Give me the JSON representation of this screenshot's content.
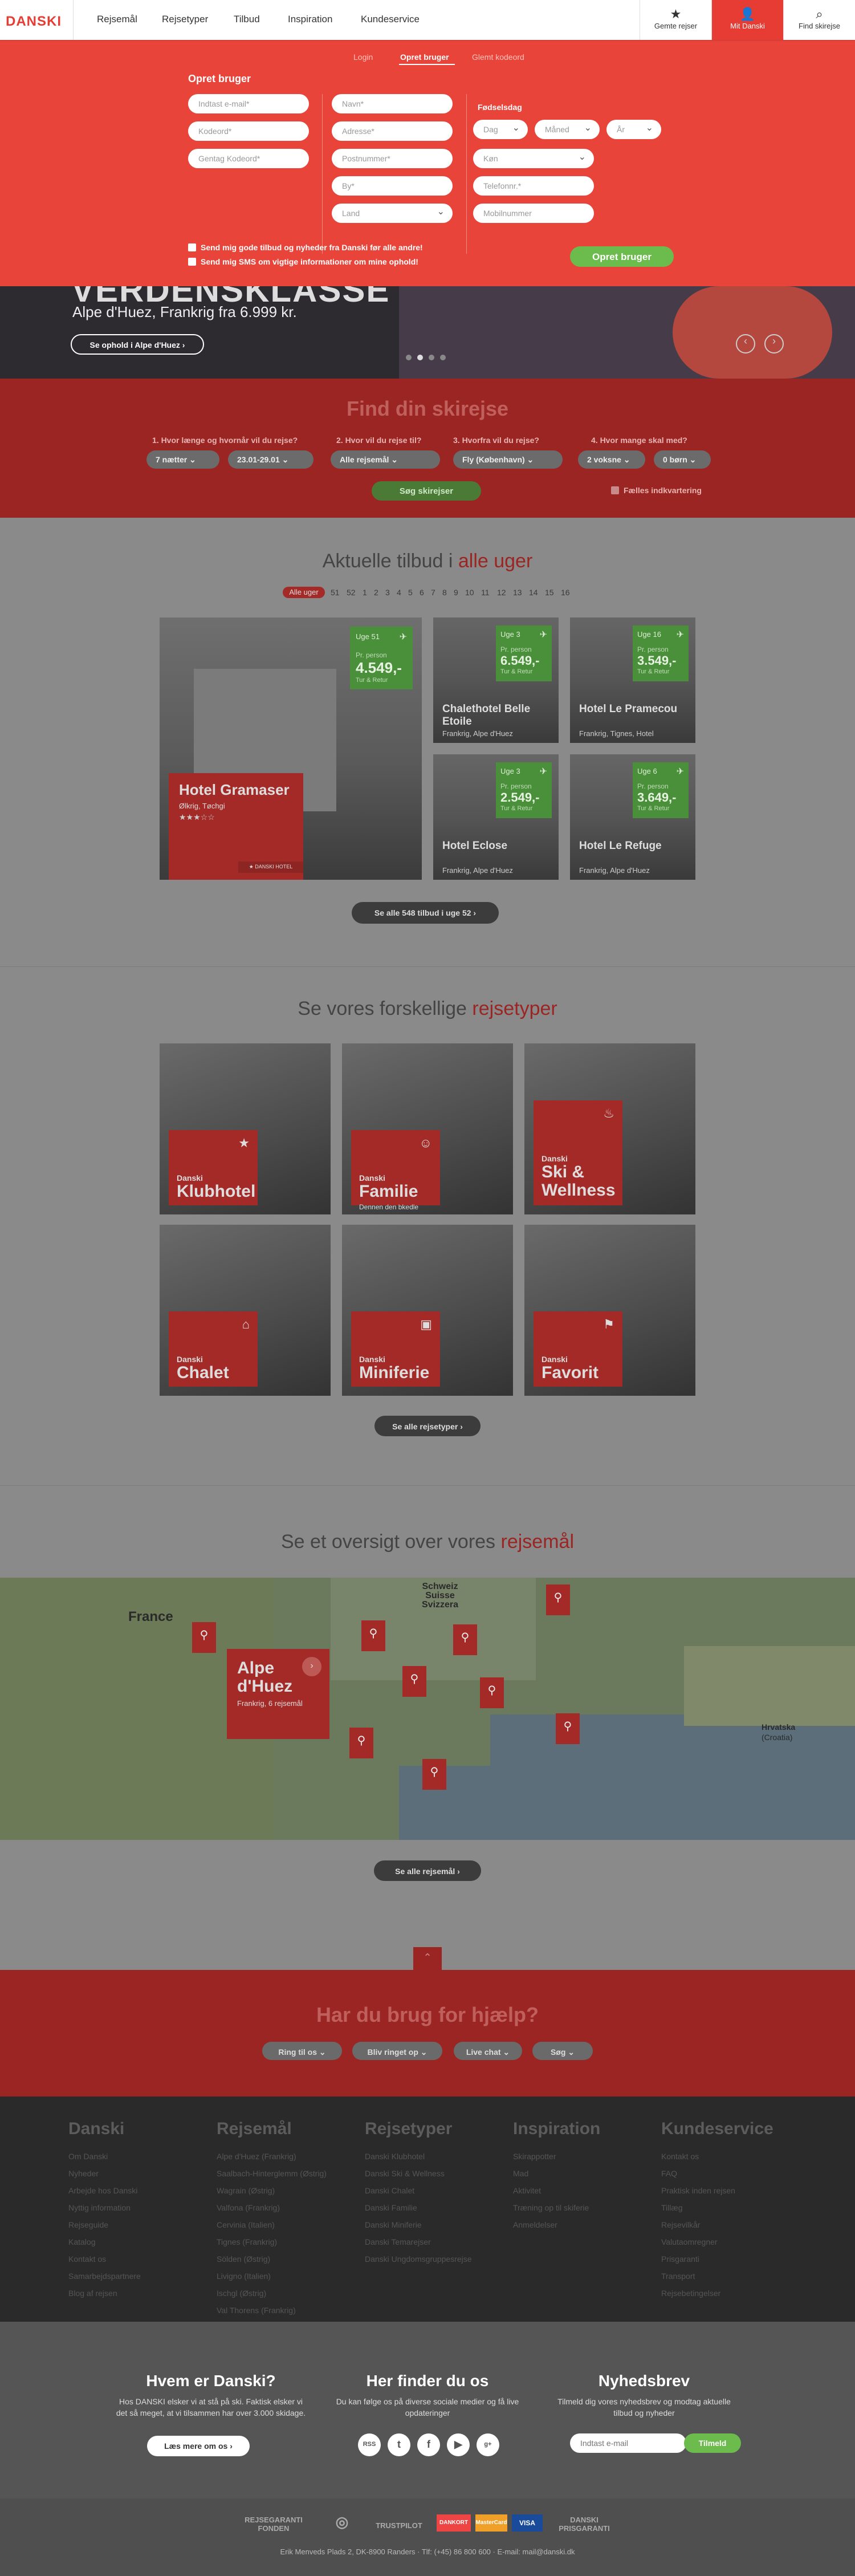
{
  "nav": {
    "logo": "DANSKI",
    "items": [
      "Rejsemål",
      "Rejsetyper",
      "Tilbud",
      "Inspiration",
      "Kundeservice"
    ],
    "saved": "Gemte rejser",
    "mine": "Mit Danski",
    "find": "Find skirejse"
  },
  "dropdown": {
    "tabs": [
      "Login",
      "Opret bruger",
      "Glemt kodeord"
    ],
    "heading": "Opret bruger",
    "col1": [
      "Indtast e-mail*",
      "Kodeord*",
      "Gentag Kodeord*"
    ],
    "col2": [
      "Navn*",
      "Adresse*",
      "Postnummer*",
      "By*",
      "Land"
    ],
    "birth_label": "Fødselsdag",
    "birth": [
      "Dag",
      "Måned",
      "År"
    ],
    "col3": [
      "Køn",
      "Telefonnr.*",
      "Mobilnummer"
    ],
    "check1": "Send mig gode tilbud og nyheder fra Danski før alle andre!",
    "check2": "Send mig SMS om vigtige informationer om mine ophold!",
    "submit": "Opret bruger"
  },
  "hero": {
    "headline": "VERDENSKLASSE",
    "sub": "Alpe d'Huez, Frankrig fra 6.999 kr.",
    "cta": "Se ophold i Alpe d'Huez",
    "prev": "‹",
    "next": "›"
  },
  "search": {
    "title": "Find din skirejse",
    "q": [
      "1. Hvor længe og hvornår vil du rejse?",
      "2. Hvor vil du rejse til?",
      "3. Hvorfra vil du rejse?",
      "4. Hvor mange skal med?"
    ],
    "values": [
      "7 nætter",
      "23.01-29.01",
      "Alle rejsemål",
      "Fly (København)",
      "2 voksne",
      "0 børn"
    ],
    "button": "Søg skirejser",
    "shared": "Fælles indkvartering"
  },
  "offers": {
    "title_a": "Aktuelle tilbud i ",
    "title_b": "alle uger",
    "weeks": [
      "Alle uger",
      "51",
      "52",
      "1",
      "2",
      "3",
      "4",
      "5",
      "6",
      "7",
      "8",
      "9",
      "10",
      "11",
      "12",
      "13",
      "14",
      "15",
      "16"
    ],
    "cards": [
      {
        "week": "Uge 51",
        "pp": "Pr. person",
        "price": "4.549,-",
        "tur": "Tur & Retur",
        "name": "Hotel Gramaser",
        "sub": "Ølkrig, Tøchgi",
        "tag": "DANSKI HOTEL"
      },
      {
        "week": "Uge 3",
        "pp": "Pr. person",
        "price": "6.549,-",
        "tur": "Tur & Retur",
        "name": "Chalethotel Belle Etoile",
        "sub": "Frankrig, Alpe d'Huez"
      },
      {
        "week": "Uge 16",
        "pp": "Pr. person",
        "price": "3.549,-",
        "tur": "Tur & Retur",
        "name": "Hotel Le Pramecou",
        "sub": "Frankrig, Tignes, Hotel"
      },
      {
        "week": "Uge 3",
        "pp": "Pr. person",
        "price": "2.549,-",
        "tur": "Tur & Retur",
        "name": "Hotel Eclose",
        "sub": "Frankrig, Alpe d'Huez"
      },
      {
        "week": "Uge 6",
        "pp": "Pr. person",
        "price": "3.649,-",
        "tur": "Tur & Retur",
        "name": "Hotel Le Refuge",
        "sub": "Frankrig, Alpe d'Huez"
      }
    ],
    "more": "Se alle 548 tilbud i uge 52"
  },
  "types": {
    "title_a": "Se vores forskellige ",
    "title_b": "rejsetyper",
    "items": [
      {
        "small": "Danski",
        "big": "Klubhotel",
        "icon": "★"
      },
      {
        "small": "Danski",
        "big": "Familie",
        "desc": "Dennen den bkedle",
        "icon": "☺"
      },
      {
        "small": "Danski",
        "big": "Ski & Wellness",
        "icon": "♨"
      },
      {
        "small": "Danski",
        "big": "Chalet",
        "icon": "⌂"
      },
      {
        "small": "Danski",
        "big": "Miniferie",
        "icon": "▣"
      },
      {
        "small": "Danski",
        "big": "Favorit",
        "icon": "⚑"
      }
    ],
    "more": "Se alle rejsetyper"
  },
  "map": {
    "title_a": "Se et oversigt over vores ",
    "title_b": "rejsemål",
    "country1": "France",
    "country2": "Schweiz\nSuisse\nSvizzera",
    "country3": "Hrvatska",
    "country4": "(Croatia)",
    "featured": "Alpe d'Huez",
    "featured_sub": "Frankrig, 6 rejsemål",
    "more": "Se alle rejsemål"
  },
  "help": {
    "title": "Har du brug for hjælp?",
    "buttons": [
      "Ring til os",
      "Bliv ringet op",
      "Live chat",
      "Søg"
    ]
  },
  "footer": {
    "cols": [
      {
        "h": "Danski",
        "items": [
          "Om Danski",
          "Nyheder",
          "Arbejde hos Danski",
          "Nyttig information",
          "Rejseguide",
          "Katalog",
          "Kontakt os",
          "Samarbejdspartnere",
          "Blog af rejsen"
        ]
      },
      {
        "h": "Rejsemål",
        "items": [
          "Alpe d'Huez (Frankrig)",
          "Saalbach-Hinterglemm (Østrig)",
          "Wagrain (Østrig)",
          "Valfona (Frankrig)",
          "Cervinia (Italien)",
          "Tignes (Frankrig)",
          "Sölden (Østrig)",
          "Livigno (Italien)",
          "Ischgl (Østrig)",
          "Val Thorens (Frankrig)"
        ]
      },
      {
        "h": "Rejsetyper",
        "items": [
          "Danski Klubhotel",
          "Danski Ski & Wellness",
          "Danski Chalet",
          "Danski Familie",
          "Danski Miniferie",
          "Danski Temarejser",
          "Danski Ungdomsgruppesrejse"
        ]
      },
      {
        "h": "Inspiration",
        "items": [
          "Skirappotter",
          "Mad",
          "Aktivitet",
          "Træning op til skiferie",
          "Anmeldelser"
        ]
      },
      {
        "h": "Kundeservice",
        "items": [
          "Kontakt os",
          "FAQ",
          "Praktisk inden rejsen",
          "Tillæg",
          "Rejsevilkår",
          "Valutaomregner",
          "Prisgaranti",
          "Transport",
          "Rejsebetingelser"
        ]
      }
    ],
    "about_h": "Hvem er Danski?",
    "about_t": "Hos DANSKI elsker vi at stå på ski. Faktisk elsker vi det så meget, at vi tilsammen har over 3.000 skidage.",
    "about_btn": "Læs mere om os",
    "find_h": "Her finder du os",
    "find_t": "Du kan følge os på diverse sociale medier og få live opdateringer",
    "social": [
      "RSS",
      "t",
      "f",
      "▶",
      "g+"
    ],
    "news_h": "Nyhedsbrev",
    "news_t": "Tilmeld dig vores nyhedsbrev og modtag aktuelle tilbud og nyheder",
    "news_ph": "Indtast e-mail",
    "news_btn": "Tilmeld",
    "badges": [
      "REJSEGARANTI FONDEN",
      "◎",
      "TRUSTPILOT",
      "DANKORT",
      "MasterCard",
      "VISA",
      "DANSKI PRISGARANTI"
    ],
    "address": "Erik Menveds Plads 2, DK-8900 Randers · Tlf: (+45) 86 800 600 · E-mail: mail@danski.dk"
  }
}
